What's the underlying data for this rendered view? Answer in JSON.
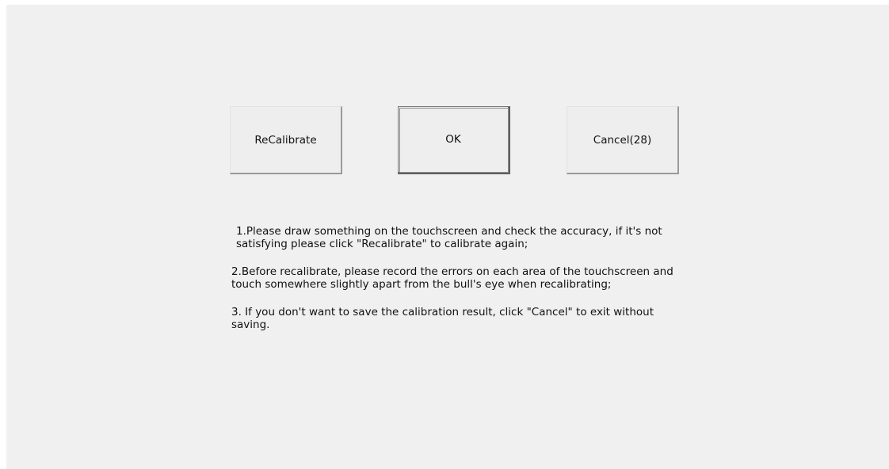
{
  "dialog": {
    "buttons": {
      "recalibrate_label": "ReCalibrate",
      "ok_label": "OK",
      "cancel_label": "Cancel(28)"
    },
    "instructions": [
      "1.Please draw something on the touchscreen and check the accuracy, if it's not satisfying please click \"Recalibrate\" to calibrate again;",
      "2.Before recalibrate, please record the errors on each area of the touchscreen and touch somewhere slightly apart from the bull's eye when recalibrating;",
      "3. If you don't want to save the calibration result, click \"Cancel\" to exit without saving."
    ]
  },
  "colors": {
    "background": "#f0f0f0",
    "button_face": "#eeeeee",
    "text": "#111111"
  }
}
